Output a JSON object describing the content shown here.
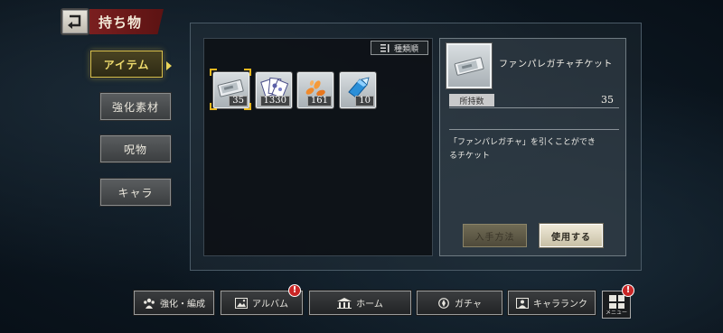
{
  "header": {
    "title": "持ち物"
  },
  "tabs": [
    {
      "label": "アイテム",
      "active": true
    },
    {
      "label": "強化素材",
      "active": false
    },
    {
      "label": "呪物",
      "active": false
    },
    {
      "label": "キャラ",
      "active": false
    }
  ],
  "sort": {
    "label": "種類順",
    "icon": "sort-icon"
  },
  "items": [
    {
      "icon": "gacha-ticket-icon",
      "count": "35",
      "selected": true
    },
    {
      "icon": "playing-cards-icon",
      "count": "1330",
      "selected": false
    },
    {
      "icon": "orange-petals-icon",
      "count": "161",
      "selected": false
    },
    {
      "icon": "blue-crystal-icon",
      "count": "10",
      "selected": false
    }
  ],
  "detail": {
    "name": "ファンパレガチャチケット",
    "owned_label": "所持数",
    "owned_value": "35",
    "description_line1": "「ファンパレガチャ」を引くことができ",
    "description_line2": "るチケット",
    "acquire_label": "入手方法",
    "use_label": "使用する"
  },
  "nav": [
    {
      "label": "強化・編成",
      "icon": "team-icon",
      "badge": false
    },
    {
      "label": "アルバム",
      "icon": "album-icon",
      "badge": true
    },
    {
      "label": "ホーム",
      "icon": "home-icon",
      "badge": false
    },
    {
      "label": "ガチャ",
      "icon": "gacha-icon",
      "badge": false
    },
    {
      "label": "キャラランク",
      "icon": "chara-rank-icon",
      "badge": false
    }
  ],
  "menu": {
    "label": "メニュー",
    "badge": true
  },
  "badge_symbol": "!",
  "colors": {
    "accent_gold": "#d9c24a",
    "title_red": "#7a1f1f",
    "badge_red": "#c92626"
  }
}
